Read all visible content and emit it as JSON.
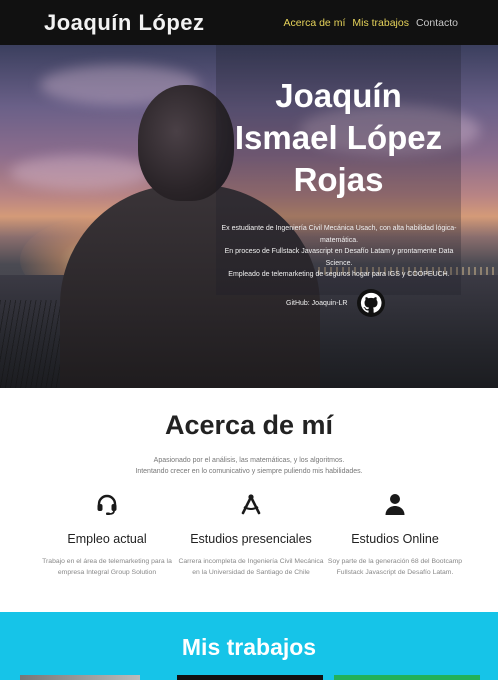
{
  "navbar": {
    "brand": "Joaquín López",
    "links": [
      {
        "label": "Acerca de mí",
        "active": true
      },
      {
        "label": "Mis trabajos",
        "active": true
      },
      {
        "label": "Contacto",
        "active": false
      }
    ]
  },
  "hero": {
    "name_lines": [
      "Joaquín",
      "Ismael López",
      "Rojas"
    ],
    "description": [
      "Ex estudiante de Ingeniería Civil Mecánica Usach, con alta habilidad lógica-matemática.",
      "En proceso de Fullstack Javascript en Desafío Latam y prontamente Data Science.",
      "Empleado de telemarketing de seguros hogar para IGS y COOPEUCH."
    ],
    "github_label": "GitHub: Joaquin-LR",
    "github_icon": "github-icon"
  },
  "about": {
    "title": "Acerca de mí",
    "subtitle": [
      "Apasionado por el análisis, las matemáticas, y los algoritmos.",
      "Intentando crecer en lo comunicativo y siempre puliendo mis habilidades."
    ],
    "features": [
      {
        "icon": "headset-icon",
        "title": "Empleo actual",
        "text": "Trabajo en el área de telemarketing para la empresa Integral Group Solution"
      },
      {
        "icon": "compass-drafting-icon",
        "title": "Estudios presenciales",
        "text": "Carrera incompleta de Ingeniería Civil Mecánica en la Universidad de Santiago de Chile"
      },
      {
        "icon": "user-icon",
        "title": "Estudios Online",
        "text": "Soy parte de la generación 68 del Bootcamp Fullstack Javascript de Desafío Latam."
      }
    ]
  },
  "works": {
    "title": "Mis trabajos"
  },
  "colors": {
    "navbar_bg": "#111111",
    "nav_active": "#e6d35a",
    "works_bg": "#16c4e8"
  }
}
